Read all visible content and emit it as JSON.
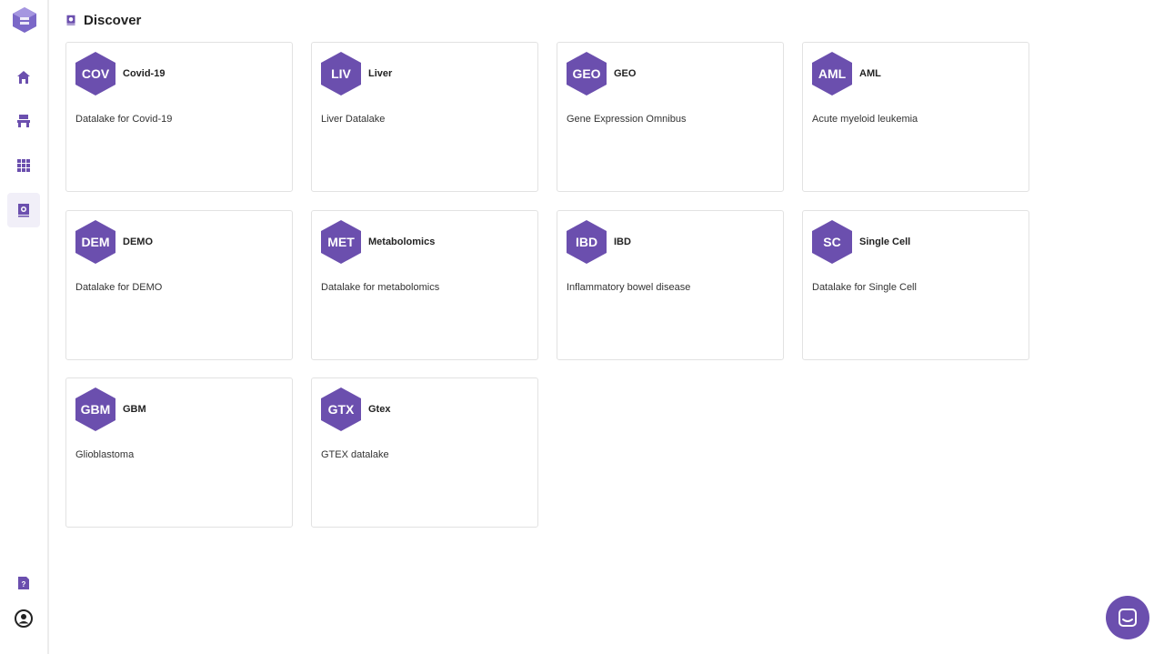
{
  "colors": {
    "accent": "#6b4fae",
    "active_bg": "#f1eff8"
  },
  "sidebar": {
    "items": [
      {
        "icon": "home-icon"
      },
      {
        "icon": "store-icon"
      },
      {
        "icon": "apps-grid-icon"
      },
      {
        "icon": "discover-icon",
        "active": true
      }
    ],
    "bottom": [
      {
        "icon": "help-doc-icon"
      },
      {
        "icon": "user-account-icon"
      }
    ]
  },
  "header": {
    "title": "Discover"
  },
  "cards": [
    {
      "abbr": "COV",
      "title": "Covid-19",
      "description": "Datalake for Covid-19"
    },
    {
      "abbr": "LIV",
      "title": "Liver",
      "description": "Liver Datalake"
    },
    {
      "abbr": "GEO",
      "title": "GEO",
      "description": "Gene Expression Omnibus"
    },
    {
      "abbr": "AML",
      "title": "AML",
      "description": "Acute myeloid leukemia"
    },
    {
      "abbr": "DEM",
      "title": "DEMO",
      "description": "Datalake for DEMO"
    },
    {
      "abbr": "MET",
      "title": "Metabolomics",
      "description": "Datalake for metabolomics"
    },
    {
      "abbr": "IBD",
      "title": "IBD",
      "description": "Inflammatory bowel disease"
    },
    {
      "abbr": "SC",
      "title": "Single Cell",
      "description": "Datalake for Single Cell"
    },
    {
      "abbr": "GBM",
      "title": "GBM",
      "description": "Glioblastoma"
    },
    {
      "abbr": "GTX",
      "title": "Gtex",
      "description": "GTEX datalake"
    }
  ]
}
